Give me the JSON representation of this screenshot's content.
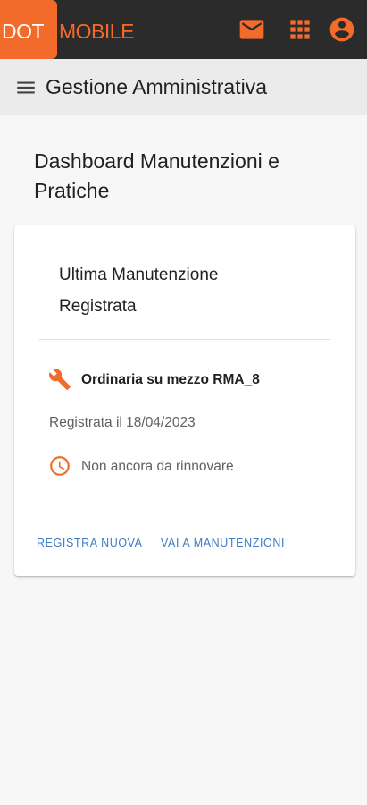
{
  "brand": {
    "logo_part1": "DOT",
    "logo_part2": "MOBILE",
    "accent_color": "#f26b2b",
    "topbar_color": "#2b2b2b"
  },
  "topbar": {
    "icons": [
      "mail-icon",
      "apps-icon",
      "account-circle-icon"
    ]
  },
  "subheader": {
    "menu_icon": "menu-icon",
    "title": "Gestione Amministrativa"
  },
  "main": {
    "page_title": "Dashboard Manutenzioni e Pratiche"
  },
  "card": {
    "title": "Ultima Manutenzione Registrata",
    "maintenance_icon": "wrench-icon",
    "maintenance_type": "Ordinaria su mezzo RMA_8",
    "registration_date": "Registrata il 18/04/2023",
    "status_icon": "clock-icon",
    "renewal_status": "Non ancora da rinnovare",
    "actions": {
      "new_label": "REGISTRA NUOVA",
      "go_label": "VAI A MANUTENZIONI"
    },
    "link_color": "#3e7bc4"
  }
}
